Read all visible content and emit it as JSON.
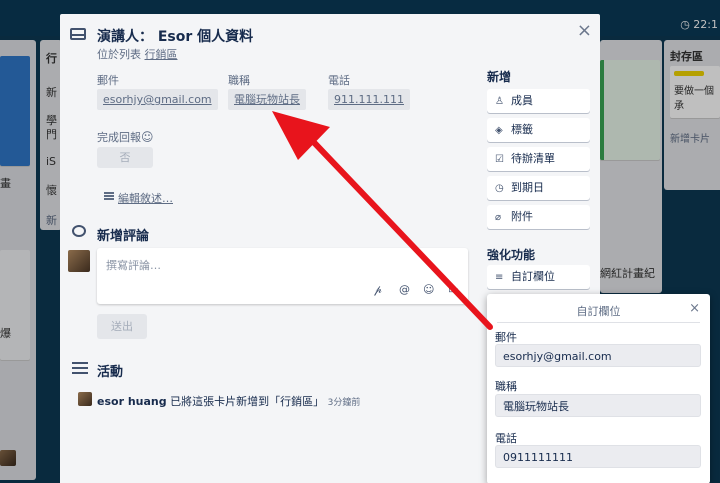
{
  "board": {
    "clock": "22:1",
    "list_left_title": "行",
    "list_right_title": "封存區",
    "right_card_text": "要做一個承",
    "add_card_right": "新增卡片",
    "green_card_text": "網紅計畫紀",
    "left_texts": [
      "新",
      "學",
      "門",
      "iS",
      "懷"
    ],
    "left_footer": "新",
    "left_misc": [
      "畫",
      "爆"
    ]
  },
  "modal": {
    "title": "演講人： Esor 個人資料",
    "in_list_prefix": "位於列表",
    "in_list_name": "行銷區",
    "close": "×",
    "fields": [
      {
        "label": "郵件",
        "value": "esorhjy@gmail.com"
      },
      {
        "label": "職稱",
        "value": "電腦玩物站長"
      },
      {
        "label": "電話",
        "value": "911.111.111"
      }
    ],
    "done_label": "完成回報",
    "done_value": "否",
    "edit_desc": "編輯敘述…",
    "comment_title": "新增評論",
    "comment_placeholder": "撰寫評論…",
    "comment_icons": [
      "𝓅",
      "@",
      "☺",
      "▭"
    ],
    "send": "送出",
    "activity_title": "活動",
    "activity": {
      "user": "esor huang",
      "text": "已將這張卡片新增到「行銷區」",
      "time": "3分鐘前"
    }
  },
  "sidebar": {
    "add_title": "新增",
    "add_buttons": [
      {
        "icon": "♙",
        "label": "成員"
      },
      {
        "icon": "◈",
        "label": "標籤"
      },
      {
        "icon": "☑",
        "label": "待辦清單"
      },
      {
        "icon": "◷",
        "label": "到期日"
      },
      {
        "icon": "⌀",
        "label": "附件"
      }
    ],
    "powerup_title": "強化功能",
    "custom_field_button": {
      "icon": "≡",
      "label": "自訂欄位"
    }
  },
  "popover": {
    "title": "自訂欄位",
    "close": "×",
    "fields": [
      {
        "label": "郵件",
        "value": "esorhjy@gmail.com"
      },
      {
        "label": "職稱",
        "value": "電腦玩物站長"
      },
      {
        "label": "電話",
        "value": "0911111111"
      }
    ]
  },
  "colors": {
    "arrow": "#e8141c",
    "board_bg": "#0c3953",
    "modal_bg": "#f4f5f7"
  }
}
